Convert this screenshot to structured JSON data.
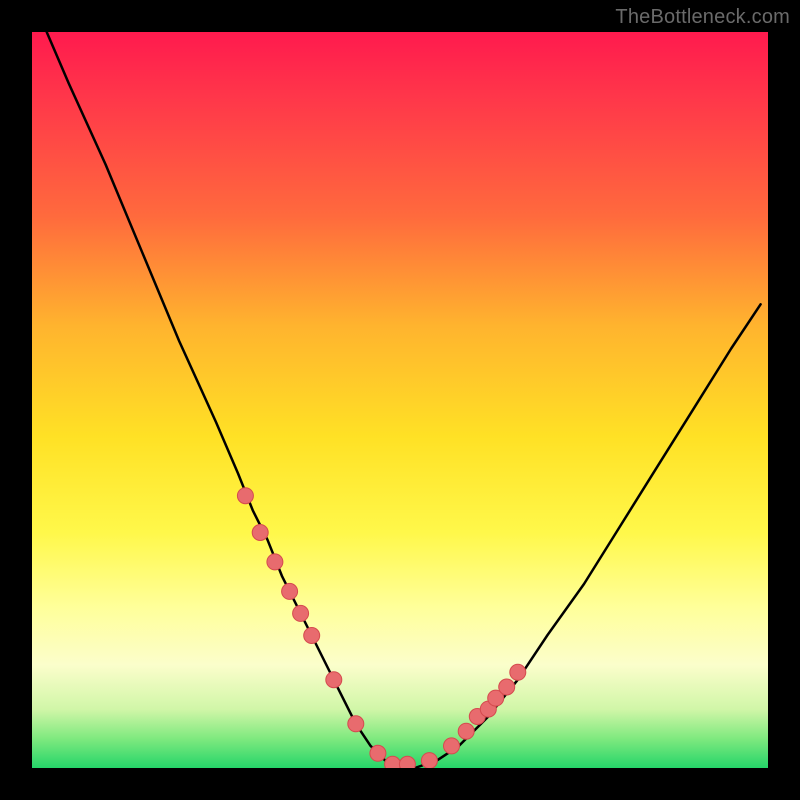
{
  "watermark": "TheBottleneck.com",
  "colors": {
    "frame": "#000000",
    "gradient_stops": [
      "#ff1a4e",
      "#ff3a49",
      "#ff6a3d",
      "#ffb42e",
      "#ffe125",
      "#fff84a",
      "#ffff99",
      "#fbfecb",
      "#d1f6a8",
      "#7fe97f",
      "#25d569"
    ],
    "curve": "#000000",
    "points_fill": "#e86b6e",
    "points_stroke": "#d54a4e"
  },
  "chart_data": {
    "type": "line",
    "title": "",
    "xlabel": "",
    "ylabel": "",
    "xlim": [
      0,
      100
    ],
    "ylim": [
      0,
      100
    ],
    "series": [
      {
        "name": "bottleneck-curve",
        "x": [
          2,
          5,
          10,
          15,
          20,
          25,
          28,
          30,
          32,
          34,
          36,
          38,
          40,
          42,
          44,
          46,
          48,
          50,
          52,
          55,
          58,
          62,
          66,
          70,
          75,
          80,
          85,
          90,
          95,
          99
        ],
        "values": [
          100,
          93,
          82,
          70,
          58,
          47,
          40,
          35,
          31,
          26,
          22,
          18,
          14,
          10,
          6,
          3,
          1,
          0,
          0,
          1,
          3,
          7,
          12,
          18,
          25,
          33,
          41,
          49,
          57,
          63
        ]
      }
    ],
    "markers": [
      {
        "name": "highlighted-points",
        "x": [
          29,
          31,
          33,
          35,
          36.5,
          38,
          41,
          44,
          47,
          49,
          51,
          54,
          57,
          59,
          60.5,
          62,
          63,
          64.5,
          66
        ],
        "values": [
          37,
          32,
          28,
          24,
          21,
          18,
          12,
          6,
          2,
          0.5,
          0.5,
          1,
          3,
          5,
          7,
          8,
          9.5,
          11,
          13
        ]
      }
    ]
  }
}
